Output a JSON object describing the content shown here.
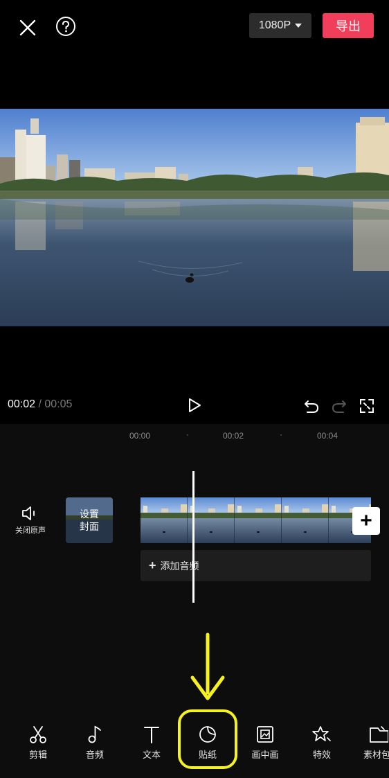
{
  "header": {
    "resolution_label": "1080P",
    "export_label": "导出"
  },
  "playback": {
    "current_time": "00:02",
    "separator": " / ",
    "total_time": "00:05"
  },
  "ruler": {
    "marks": [
      "00:00",
      "00:02",
      "00:04"
    ],
    "dot": "·"
  },
  "timeline": {
    "mute_label": "关闭原声",
    "cover_line1": "设置",
    "cover_line2": "封面",
    "add_audio_label": "添加音频",
    "add_audio_plus": "+",
    "add_clip_plus": "+"
  },
  "toolbar": {
    "items": [
      {
        "label": "剪辑",
        "icon": "scissors-icon"
      },
      {
        "label": "音频",
        "icon": "music-note-icon"
      },
      {
        "label": "文本",
        "icon": "text-icon"
      },
      {
        "label": "贴纸",
        "icon": "sticker-icon"
      },
      {
        "label": "画中画",
        "icon": "picture-in-picture-icon"
      },
      {
        "label": "特效",
        "icon": "effects-star-icon"
      },
      {
        "label": "素材包",
        "icon": "material-pack-icon"
      }
    ]
  },
  "colors": {
    "export_button": "#f03e5b",
    "highlight": "#f6f21e",
    "background": "#000000"
  }
}
